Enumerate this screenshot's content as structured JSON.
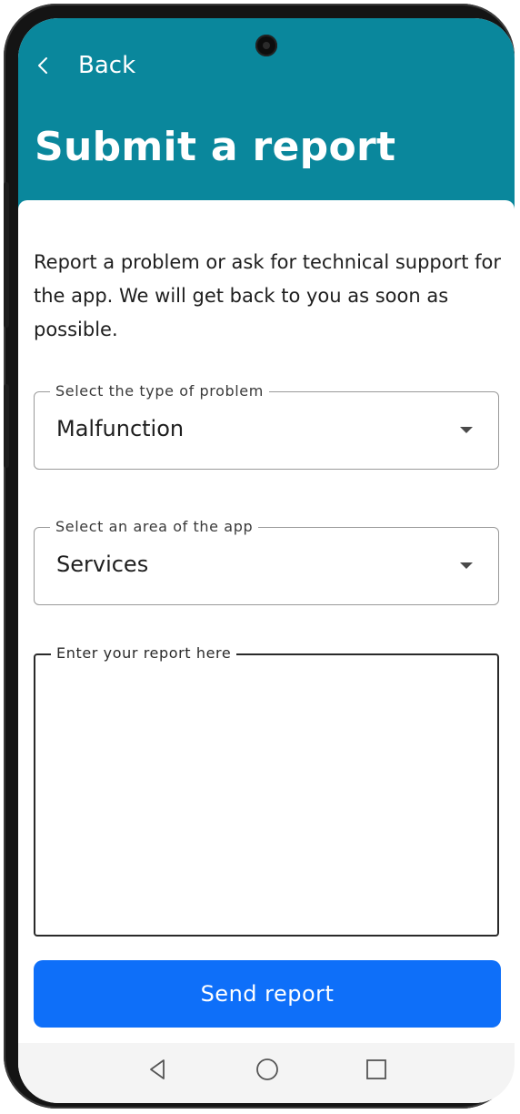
{
  "header": {
    "back_label": "Back",
    "title": "Submit a report",
    "background_color": "#0a879c"
  },
  "intro_text": "Report a problem or ask for technical support for the app. We will get back to you as soon as possible.",
  "form": {
    "problem_type": {
      "label": "Select the type of problem",
      "value": "Malfunction"
    },
    "app_area": {
      "label": "Select an area of the app",
      "value": "Services"
    },
    "report": {
      "label": "Enter your report here",
      "value": ""
    }
  },
  "send_button": {
    "label": "Send report",
    "color": "#0e6ff9"
  },
  "navigation_bar": {
    "icons": [
      "nav-back-icon",
      "nav-home-icon",
      "nav-recents-icon"
    ]
  }
}
